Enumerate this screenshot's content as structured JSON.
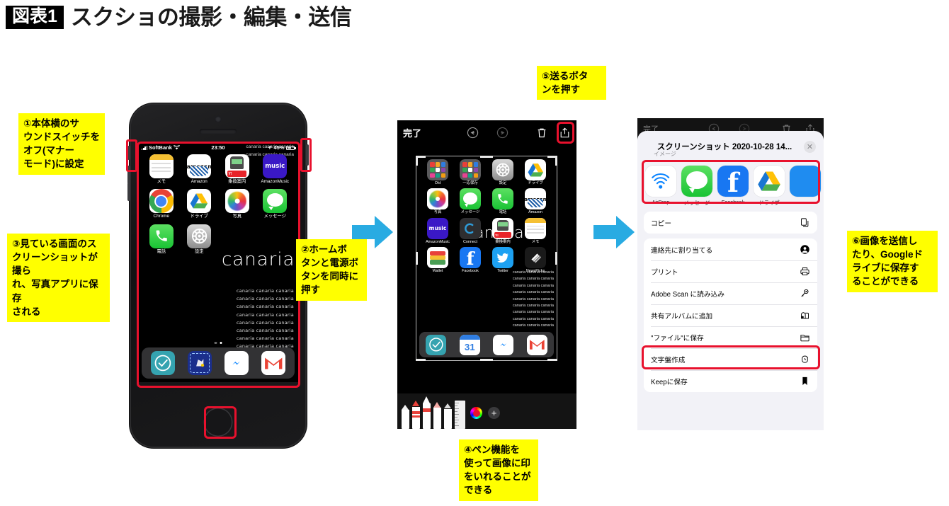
{
  "title": {
    "badge": "図表1",
    "text": "スクショの撮影・編集・送信"
  },
  "callouts": [
    {
      "id": "c1",
      "text": "①本体横のサ\nウンドスイッチを\nオフ(マナー\nモード)に設定"
    },
    {
      "id": "c3",
      "text": "③見ている画面のス\nクリーンショットが撮ら\nれ、写真アプリに保存\nされる"
    },
    {
      "id": "c2",
      "text": "②ホームボ\nタンと電源ボ\nタンを同時に\n押す"
    },
    {
      "id": "c4",
      "text": "④ペン機能を\n使って画像に印\nをいれることが\nできる"
    },
    {
      "id": "c5",
      "text": "⑤送るボタ\nンを押す"
    },
    {
      "id": "c6",
      "text": "⑥画像を送信し\nたり、Googleド\nライブに保存す\nることができる"
    }
  ],
  "phone": {
    "statusbar": {
      "carrier": "SoftBank",
      "time": "23:50",
      "battery_percent": "45%",
      "wifi_icon": "wifi-icon",
      "signal_icon": "signal-bars-icon",
      "location_icon": "location-arrow-icon",
      "battery_icon": "battery-icon"
    },
    "wallpaper": {
      "brand": "canaria",
      "repeat_line": "canaria canaria canaria",
      "repeat_count": 8
    },
    "apps": [
      {
        "label": "メモ",
        "icon": "notes-icon"
      },
      {
        "label": "Amazon",
        "icon": "amazon-icon"
      },
      {
        "label": "乗換案内",
        "icon": "transit-icon"
      },
      {
        "label": "AmazonMusic",
        "icon": "amazon-music-icon"
      },
      {
        "label": "Chrome",
        "icon": "chrome-icon"
      },
      {
        "label": "ドライブ",
        "icon": "google-drive-icon"
      },
      {
        "label": "写真",
        "icon": "photos-icon"
      },
      {
        "label": "メッセージ",
        "icon": "messages-icon"
      },
      {
        "label": "電話",
        "icon": "phone-icon"
      },
      {
        "label": "設定",
        "icon": "settings-icon"
      }
    ],
    "dock": [
      {
        "label": "check-app",
        "icon": "check-circle-icon"
      },
      {
        "label": "map-app",
        "icon": "map-app-icon"
      },
      {
        "label": "Messenger",
        "icon": "messenger-icon"
      },
      {
        "label": "Gmail",
        "icon": "gmail-icon"
      }
    ],
    "page_dots": 2,
    "active_dot": 2
  },
  "markup_editor": {
    "done_label": "完了",
    "toolbar_icons": [
      "undo-icon",
      "redo-icon",
      "trash-icon",
      "share-icon"
    ],
    "apps": [
      {
        "label": "Old",
        "icon": "folder-old-icon"
      },
      {
        "label": "一応保存",
        "icon": "folder-save-icon"
      },
      {
        "label": "設定",
        "icon": "settings-icon"
      },
      {
        "label": "ドライブ",
        "icon": "google-drive-icon"
      },
      {
        "label": "写真",
        "icon": "photos-icon"
      },
      {
        "label": "メッセージ",
        "icon": "messages-icon"
      },
      {
        "label": "電話",
        "icon": "phone-icon"
      },
      {
        "label": "Amazon",
        "icon": "amazon-icon"
      },
      {
        "label": "AmazonMusic",
        "icon": "amazon-music-icon"
      },
      {
        "label": "Connect",
        "icon": "connect-icon"
      },
      {
        "label": "乗換案内",
        "icon": "transit-icon"
      },
      {
        "label": "メモ",
        "icon": "notes-icon"
      },
      {
        "label": "Wallet",
        "icon": "wallet-icon"
      },
      {
        "label": "Facebook",
        "icon": "facebook-icon"
      },
      {
        "label": "Twitter",
        "icon": "twitter-icon"
      },
      {
        "label": "NewsPicks",
        "icon": "newspicks-icon"
      }
    ],
    "dock": [
      {
        "label": "check-app",
        "icon": "check-circle-icon"
      },
      {
        "label": "calendar",
        "icon": "calendar-31-icon"
      },
      {
        "label": "Messenger",
        "icon": "messenger-icon"
      },
      {
        "label": "Gmail",
        "icon": "gmail-icon"
      }
    ],
    "wallpaper_brand": "canaria",
    "wallpaper_line": "canaria canaria canaria",
    "pen_tools": [
      "pen-tool",
      "marker-tool",
      "felt-pen-tool",
      "pencil-tool",
      "eraser-tool",
      "ruler-tool"
    ],
    "color_swatch": "#e8112d",
    "add_label": "+"
  },
  "share_sheet": {
    "title": "スクリーンショット 2020-10-28 14...",
    "subtitle": "イメージ",
    "close_icon": "close-icon",
    "apps": [
      {
        "label": "AirDrop",
        "icon": "airdrop-icon"
      },
      {
        "label": "メッセージ",
        "icon": "messages-icon"
      },
      {
        "label": "Facebook",
        "icon": "facebook-icon"
      },
      {
        "label": "ドライブ",
        "icon": "google-drive-icon"
      }
    ],
    "actions_group1": [
      {
        "label": "コピー",
        "icon": "copy-icon"
      }
    ],
    "actions_group2": [
      {
        "label": "連絡先に割り当てる",
        "icon": "contact-icon"
      },
      {
        "label": "プリント",
        "icon": "printer-icon"
      },
      {
        "label": "Adobe Scan に読み込み",
        "icon": "adobe-scan-icon"
      },
      {
        "label": "共有アルバムに追加",
        "icon": "shared-album-icon"
      },
      {
        "label": "\"ファイル\"に保存",
        "icon": "folder-icon"
      },
      {
        "label": "文字盤作成",
        "icon": "watch-face-icon"
      },
      {
        "label": "Keepに保存",
        "icon": "bookmark-icon"
      }
    ]
  },
  "colors": {
    "callout_bg": "#ffff00",
    "highlight_red": "#e8112d",
    "arrow_blue": "#29abe2",
    "badge_bg": "#000000"
  }
}
